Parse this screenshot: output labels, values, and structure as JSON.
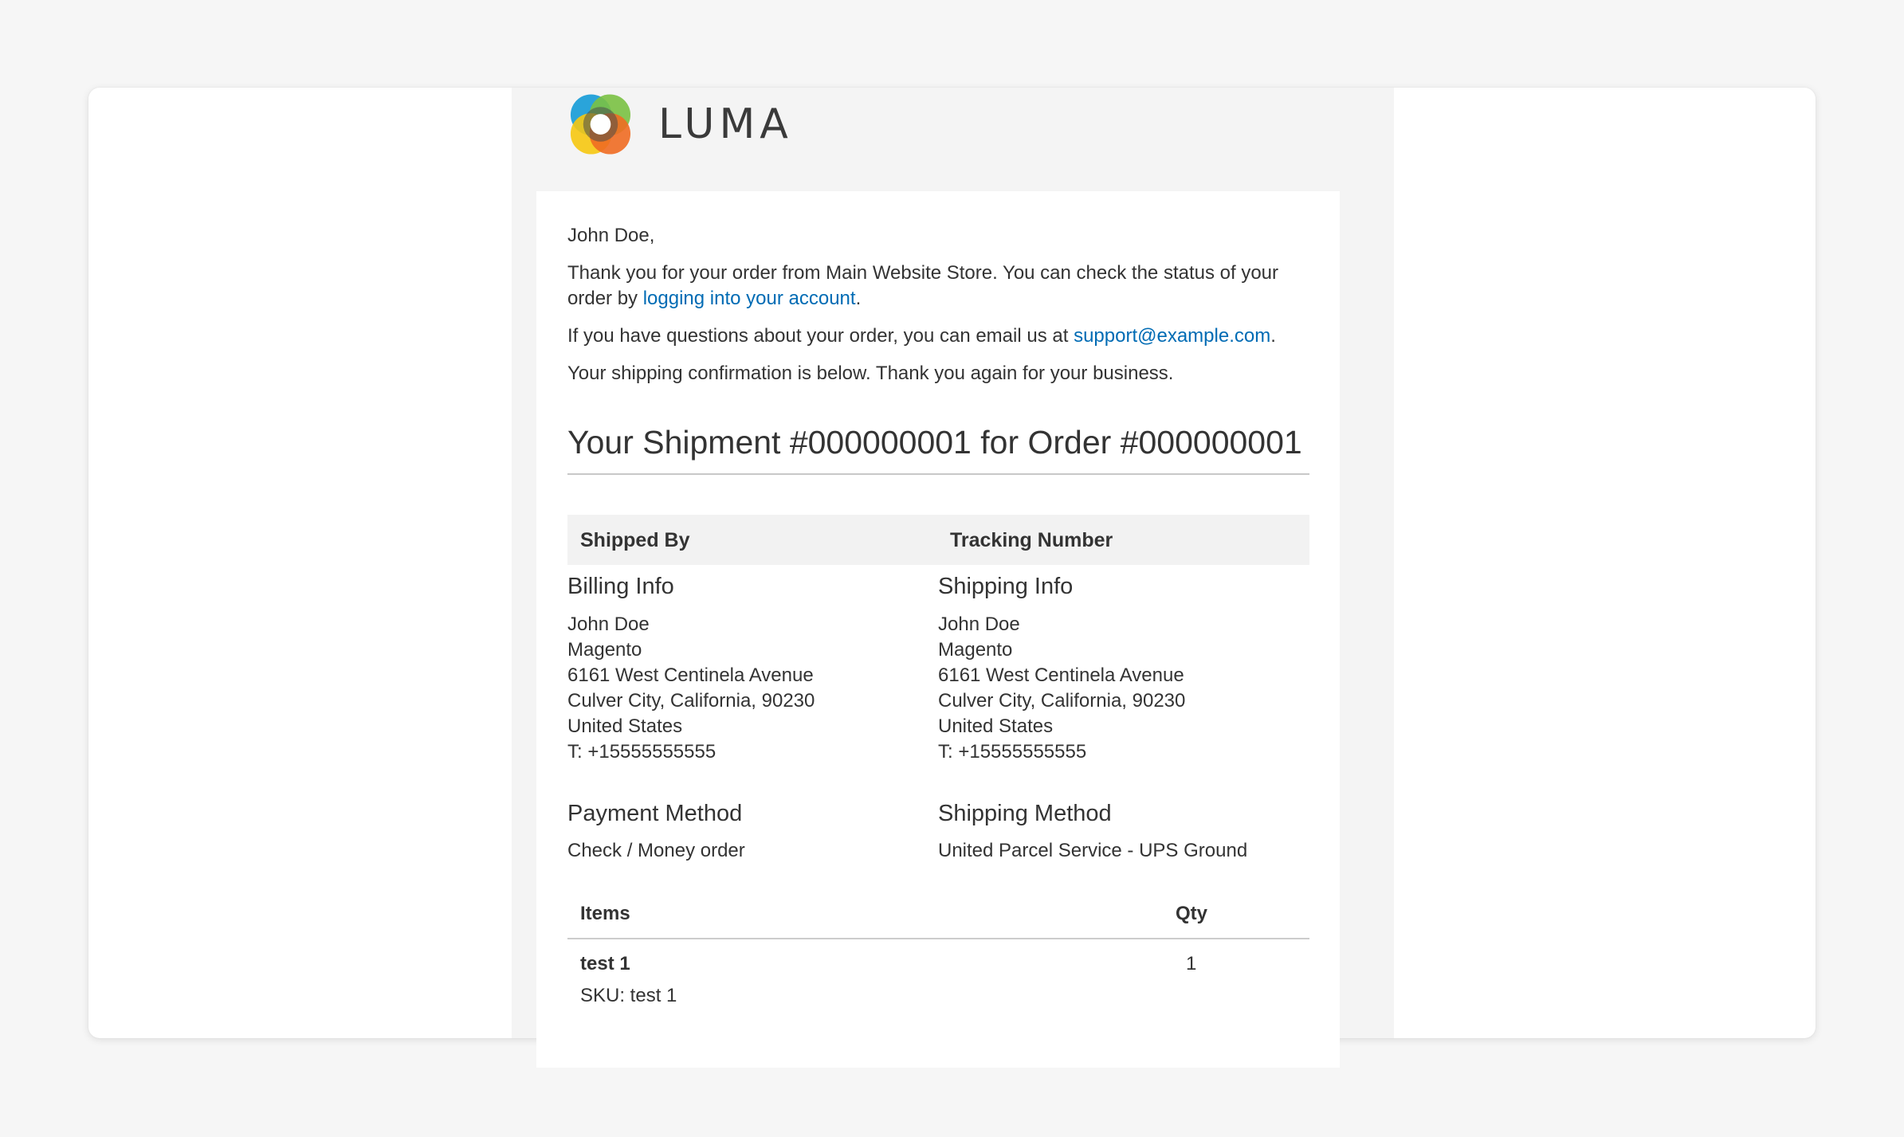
{
  "brand": {
    "logo_text": "LUMA",
    "logo_icon": "luma-ring-logo",
    "colors": {
      "blue": "#1f9fd8",
      "green": "#7ac142",
      "yellow": "#f6c811",
      "orange": "#ef6c22",
      "dark": "#4a4a4a"
    }
  },
  "colors": {
    "link": "#006bb4",
    "text": "#333333",
    "background": "#f4f4f4"
  },
  "greeting": "John Doe,",
  "intro": {
    "line1": "Thank you for your order from Main Website Store. You can check the status of your",
    "line2_prefix": "order by ",
    "link_text": "logging into your account",
    "line2_suffix": "."
  },
  "questions": {
    "prefix": "If you have questions about your order, you can email us at ",
    "email": "support@example.com",
    "suffix": "."
  },
  "confirmation": "Your shipping confirmation is below. Thank you again for your business.",
  "title": "Your Shipment #000000001 for Order #000000001",
  "shipment_table": {
    "col1": "Shipped By",
    "col2": "Tracking Number"
  },
  "billing": {
    "heading": "Billing Info",
    "lines": [
      "John Doe",
      "Magento",
      "6161 West Centinela Avenue",
      "Culver City, California, 90230",
      "United States",
      "T: +15555555555"
    ]
  },
  "shipping": {
    "heading": "Shipping Info",
    "lines": [
      "John Doe",
      "Magento",
      "6161 West Centinela Avenue",
      "Culver City, California, 90230",
      "United States",
      "T: +15555555555"
    ]
  },
  "payment": {
    "heading": "Payment Method",
    "value": "Check / Money order"
  },
  "shipping_method": {
    "heading": "Shipping Method",
    "value": "United Parcel Service - UPS Ground"
  },
  "items": {
    "col_items": "Items",
    "col_qty": "Qty",
    "rows": [
      {
        "name": "test 1",
        "sku": "SKU: test 1",
        "qty": "1"
      }
    ]
  }
}
